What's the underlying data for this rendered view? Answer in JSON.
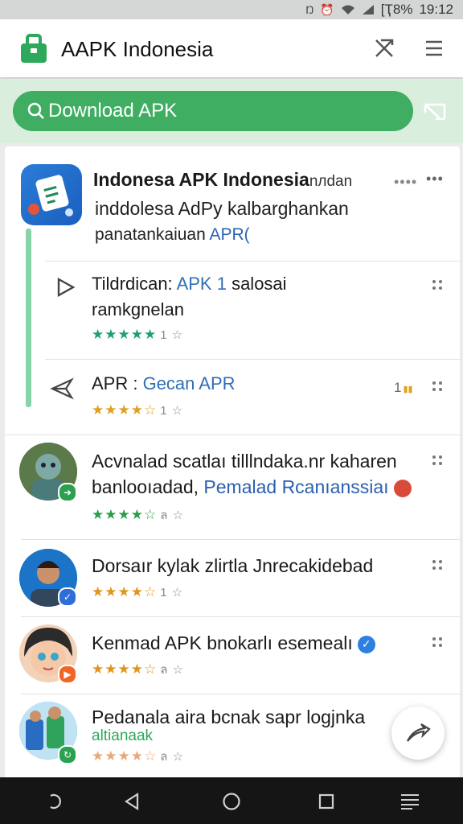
{
  "status_bar": {
    "battery": "[Ҭ8%",
    "time": "19:12",
    "icons": [
      "n-icon",
      "alarm-icon",
      "wifi-icon",
      "signal-icon"
    ]
  },
  "app_bar": {
    "title": "AAPK Indonesia",
    "icons": [
      "app-logo-icon",
      "pin-icon",
      "menu-icon"
    ]
  },
  "search": {
    "label": "Download APK",
    "icon": "search-icon",
    "scan_icon": "scan-icon",
    "accent": "#3fae62"
  },
  "featured": {
    "title": "Indonesa APK Indonesia",
    "title_suffix": "nлdan",
    "subtitle_line1": "inddolesa AdPy kalbarghankan",
    "subtitle_line2_a": "panatankaiuan ",
    "subtitle_line2_b": "APR(",
    "more_label": "••••",
    "rows": [
      {
        "text_a": "Tildrdican: ",
        "text_b": "APK 1",
        "text_c": " salosai",
        "line2": "ramkgnelan",
        "stars": "★★★★★",
        "count": "1 ☆",
        "star_color": "#1f9e7a",
        "icon": "play-outline-icon"
      },
      {
        "text_a": "APR : ",
        "text_b": "Gecan APR",
        "stars": "★★★★☆",
        "count": "1 ☆",
        "star_color": "#e0a020",
        "side_label": "1",
        "icon": "send-icon"
      }
    ]
  },
  "list": [
    {
      "line1": "Acvnalad scatlaı tilllndaka.nr kaharen",
      "line2_a": "banlooıadad, ",
      "line2_b": "Pemalad Rcanıanssiaı",
      "stars": "★★★★☆",
      "count": "ล ☆",
      "star_color": "#2a9e4a",
      "avatar": "statue-avatar",
      "badge_color": "#2aa14f"
    },
    {
      "line1": "Dorsaır kylak zlirtla Jnrecakidebad",
      "stars": "★★★★☆",
      "count": "1 ☆",
      "star_color": "#e0961c",
      "avatar": "man-avatar",
      "badge_color": "#2d6fd6"
    },
    {
      "line1": "Kenmad APK bnokarlı esemealı",
      "stars": "★★★★☆",
      "count": "ล ☆",
      "star_color": "#e0961c",
      "avatar": "cartoon-girl-avatar",
      "badge_color": "#f26522"
    },
    {
      "line1": "Pedanala aira bcnak sapr logjnka",
      "line2": "altianaak",
      "stars": "★★★★☆",
      "count": "ล ☆",
      "star_color": "#e8a87c",
      "avatar": "group-phones-avatar",
      "badge_color": "#2aa14f"
    }
  ],
  "fab": {
    "icon": "share-arrow-icon"
  },
  "nav_bar": {
    "icons": [
      "recent-back-icon",
      "back-icon",
      "home-icon",
      "overview-icon",
      "menu-lines-icon"
    ]
  }
}
